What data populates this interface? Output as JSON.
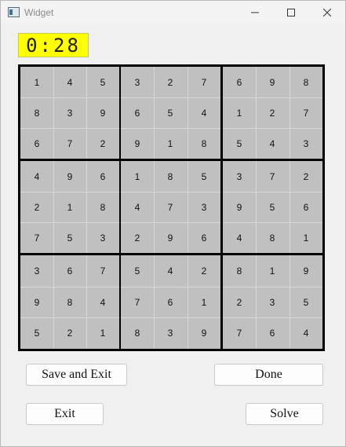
{
  "window": {
    "title": "Widget",
    "icons": {
      "app": "app-window-icon",
      "minimize": "minimize-icon",
      "maximize": "maximize-icon",
      "close": "close-icon"
    }
  },
  "timer": {
    "display": "0:28",
    "background": "#ffff00"
  },
  "board": {
    "grid": [
      [
        1,
        4,
        5,
        3,
        2,
        7,
        6,
        9,
        8
      ],
      [
        8,
        3,
        9,
        6,
        5,
        4,
        1,
        2,
        7
      ],
      [
        6,
        7,
        2,
        9,
        1,
        8,
        5,
        4,
        3
      ],
      [
        4,
        9,
        6,
        1,
        8,
        5,
        3,
        7,
        2
      ],
      [
        2,
        1,
        8,
        4,
        7,
        3,
        9,
        5,
        6
      ],
      [
        7,
        5,
        3,
        2,
        9,
        6,
        4,
        8,
        1
      ],
      [
        3,
        6,
        7,
        5,
        4,
        2,
        8,
        1,
        9
      ],
      [
        9,
        8,
        4,
        7,
        6,
        1,
        2,
        3,
        5
      ],
      [
        5,
        2,
        1,
        8,
        3,
        9,
        7,
        6,
        4
      ]
    ],
    "cell_color": "#c0c0c0",
    "border_color": "#000000"
  },
  "buttons": {
    "save_exit": "Save and Exit",
    "done": "Done",
    "exit": "Exit",
    "solve": "Solve"
  }
}
